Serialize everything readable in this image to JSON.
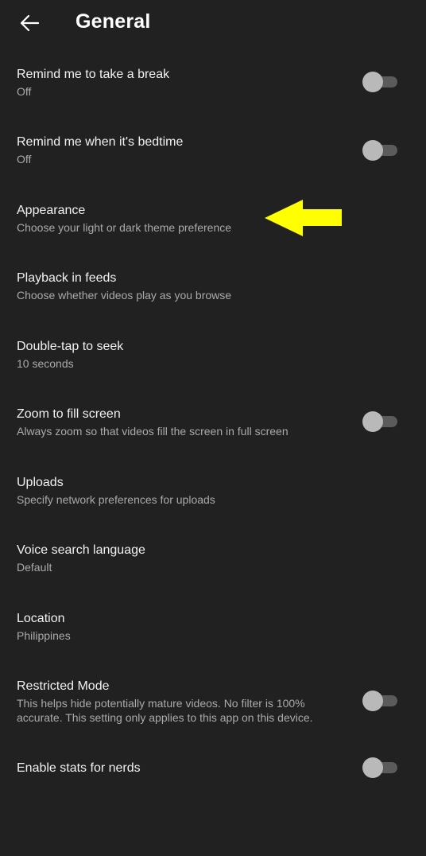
{
  "header": {
    "title": "General",
    "back_icon": "arrow-left-icon"
  },
  "settings": [
    {
      "title": "Remind me to take a break",
      "subtitle": "Off",
      "toggle": false
    },
    {
      "title": "Remind me when it's bedtime",
      "subtitle": "Off",
      "toggle": false
    },
    {
      "title": "Appearance",
      "subtitle": "Choose your light or dark theme preference"
    },
    {
      "title": "Playback in feeds",
      "subtitle": "Choose whether videos play as you browse"
    },
    {
      "title": "Double-tap to seek",
      "subtitle": "10 seconds"
    },
    {
      "title": "Zoom to fill screen",
      "subtitle": "Always zoom so that videos fill the screen in full screen",
      "toggle": false
    },
    {
      "title": "Uploads",
      "subtitle": "Specify network preferences for uploads"
    },
    {
      "title": "Voice search language",
      "subtitle": "Default"
    },
    {
      "title": "Location",
      "subtitle": "Philippines"
    },
    {
      "title": "Restricted Mode",
      "subtitle": "This helps hide potentially mature videos. No filter is 100% accurate. This setting only applies to this app on this device.",
      "toggle": false
    },
    {
      "title": "Enable stats for nerds",
      "toggle": false
    }
  ],
  "annotation": {
    "icon": "yellow-arrow-left-icon",
    "color": "#ffff00"
  },
  "colors": {
    "background": "#212121",
    "text_primary": "#f1f1f1",
    "text_secondary": "#aaaaaa",
    "toggle_track_off": "#5b5b5b",
    "toggle_knob_off": "#b9b9b9"
  }
}
